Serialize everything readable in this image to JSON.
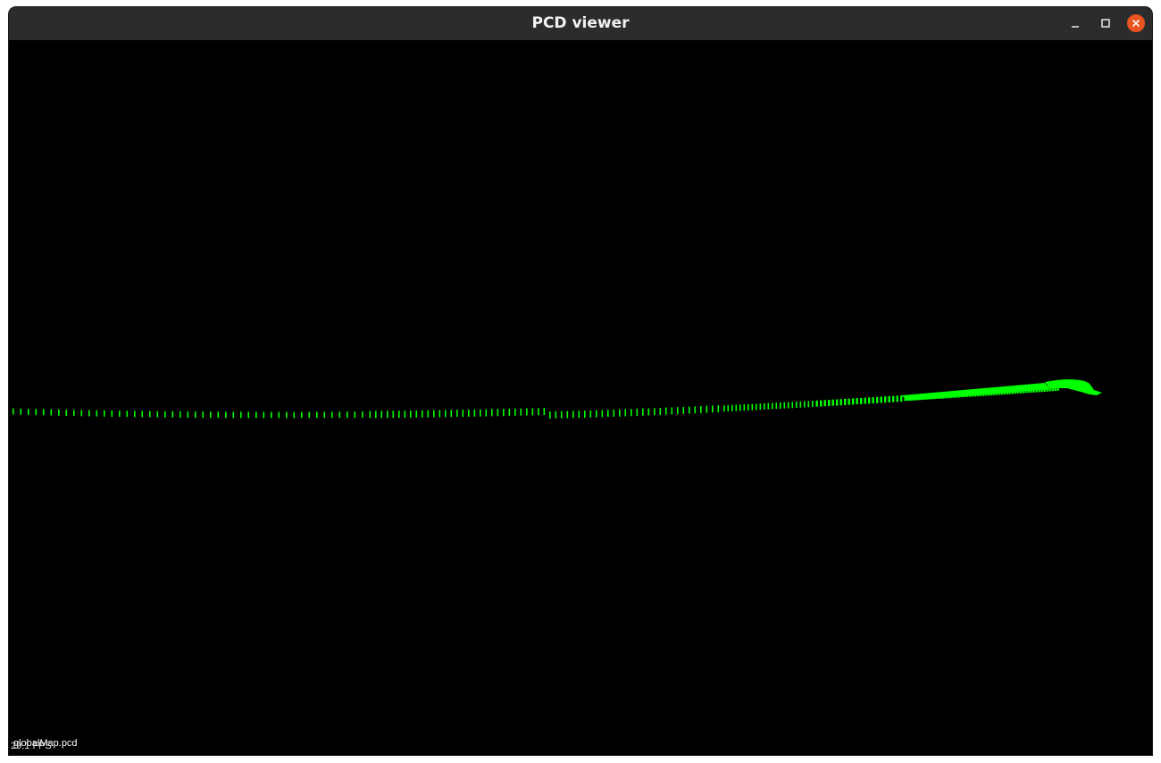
{
  "window": {
    "title": "PCD viewer"
  },
  "controls": {
    "minimize_icon": "minimize-icon",
    "maximize_icon": "maximize-icon",
    "close_icon": "close-icon",
    "close_color": "#e95420"
  },
  "viewer": {
    "background": "#000000",
    "point_color": "#00ff00",
    "file_name": "globalMap.pcd",
    "fps_text": "29.1 FPS"
  }
}
